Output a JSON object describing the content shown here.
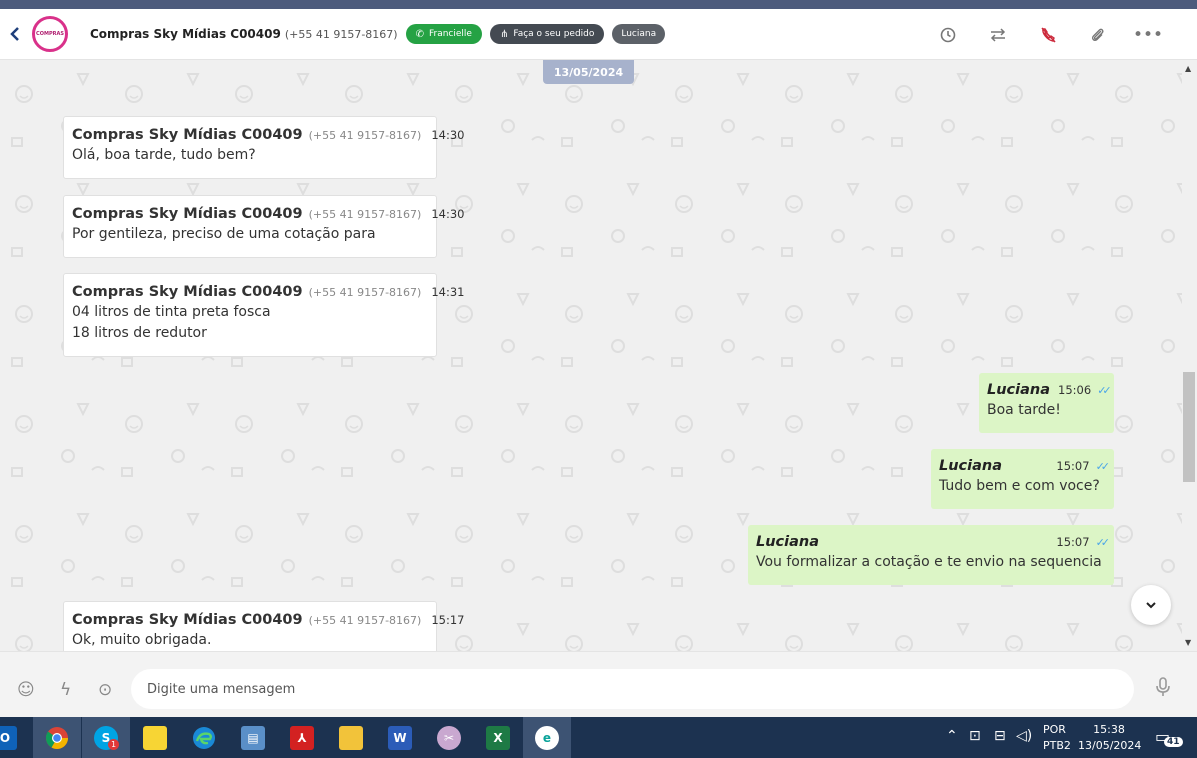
{
  "header": {
    "logo_text": "COMPRAS",
    "contact_name": "Compras Sky Mídias C00409",
    "contact_phone": "(+55 41 9157-8167)",
    "tags": [
      {
        "label": "Francielle",
        "color": "#25a244",
        "icon": "whatsapp-icon"
      },
      {
        "label": "Faça o seu pedido",
        "color": "#444a52",
        "icon": "network-icon"
      },
      {
        "label": "Luciana",
        "color": "#5c6168"
      }
    ],
    "actions": [
      "history-icon",
      "transfer-icon",
      "hangup-icon",
      "attach-icon",
      "more-icon"
    ]
  },
  "chat": {
    "date": "13/05/2024",
    "incoming": [
      {
        "sender": "Compras Sky Mídias C00409",
        "phone": "(+55 41 9157-8167)",
        "time": "14:30",
        "lines": [
          "Olá, boa tarde, tudo bem?"
        ]
      },
      {
        "sender": "Compras Sky Mídias C00409",
        "phone": "(+55 41 9157-8167)",
        "time": "14:30",
        "lines": [
          "Por gentileza, preciso de uma cotação para"
        ]
      },
      {
        "sender": "Compras Sky Mídias C00409",
        "phone": "(+55 41 9157-8167)",
        "time": "14:31",
        "lines": [
          "04 litros de tinta preta fosca",
          "18 litros de redutor"
        ]
      },
      {
        "sender": "Compras Sky Mídias C00409",
        "phone": "(+55 41 9157-8167)",
        "time": "15:17",
        "lines": [
          "Ok, muito obrigada."
        ]
      }
    ],
    "outgoing": [
      {
        "sender": "Luciana",
        "time": "15:06",
        "text": "Boa tarde!"
      },
      {
        "sender": "Luciana",
        "time": "15:07",
        "text": "Tudo bem e com voce?"
      },
      {
        "sender": "Luciana",
        "time": "15:07",
        "text": "Vou formalizar a cotação e te envio na sequencia"
      }
    ]
  },
  "composer": {
    "placeholder": "Digite uma mensagem"
  },
  "taskbar": {
    "lang_line1": "POR",
    "lang_line2": "PTB2",
    "time": "15:38",
    "date": "13/05/2024",
    "notifications": "41",
    "skype_badge": "1"
  }
}
